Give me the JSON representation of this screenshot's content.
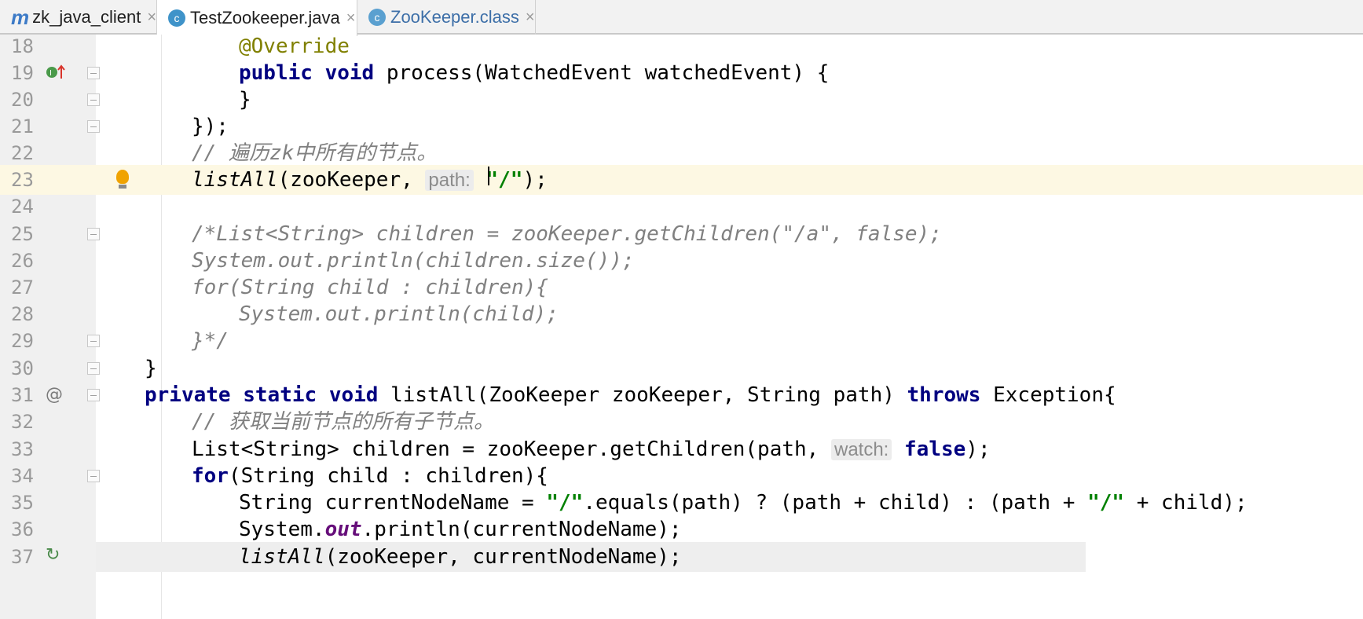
{
  "tabs": [
    {
      "label": "zk_java_client",
      "icon": "m-logo",
      "active": false
    },
    {
      "label": "TestZookeeper.java",
      "icon": "java-class-icon",
      "active": true
    },
    {
      "label": "ZooKeeper.class",
      "icon": "class-icon",
      "active": false
    }
  ],
  "tab_close_glyph": "×",
  "cursor_line": "23",
  "lines": [
    {
      "num": "18",
      "ann": "@Override"
    },
    {
      "num": "19",
      "t1": "public",
      "t2": "void",
      "rest": " process(WatchedEvent watchedEvent) {",
      "gutter_icon": "implements-icon"
    },
    {
      "num": "20",
      "text": "}"
    },
    {
      "num": "21",
      "text": "});"
    },
    {
      "num": "22",
      "comment": "// 遍历zk中所有的节点。"
    },
    {
      "num": "23",
      "fn": "listAll",
      "pre": "(zooKeeper, ",
      "hint": "path:",
      "str": "\"/\"",
      "post": ");"
    },
    {
      "num": "24",
      "text": ""
    },
    {
      "num": "25",
      "comment": "/*List<String> children = zooKeeper.getChildren(\"/a\", false);"
    },
    {
      "num": "26",
      "comment": "System.out.println(children.size());"
    },
    {
      "num": "27",
      "comment": "for(String child : children){"
    },
    {
      "num": "28",
      "comment": "System.out.println(child);"
    },
    {
      "num": "29",
      "comment": "}*/"
    },
    {
      "num": "30",
      "text": "}"
    },
    {
      "num": "31",
      "k1": "private",
      "k2": "static",
      "k3": "void",
      "mid": " listAll(ZooKeeper zooKeeper, String path) ",
      "k4": "throws",
      "end": " Exception{",
      "gutter_icon": "at-icon"
    },
    {
      "num": "32",
      "comment": "// 获取当前节点的所有子节点。"
    },
    {
      "num": "33",
      "pre": "List<String> children = zooKeeper.getChildren(path, ",
      "hint": "watch:",
      "kw": "false",
      "post": ");"
    },
    {
      "num": "34",
      "kw": "for",
      "rest": "(String child : children){"
    },
    {
      "num": "35",
      "pre": "String currentNodeName = ",
      "s1": "\"/\"",
      "mid": ".equals(path) ? (path + child) : (path + ",
      "s2": "\"/\"",
      "post": " + child);"
    },
    {
      "num": "36",
      "pre": "System.",
      "field": "out",
      "post": ".println(currentNodeName);"
    },
    {
      "num": "37",
      "fn": "listAll",
      "rest": "(zooKeeper, currentNodeName);",
      "gutter_icon": "recursive-call-icon"
    }
  ]
}
